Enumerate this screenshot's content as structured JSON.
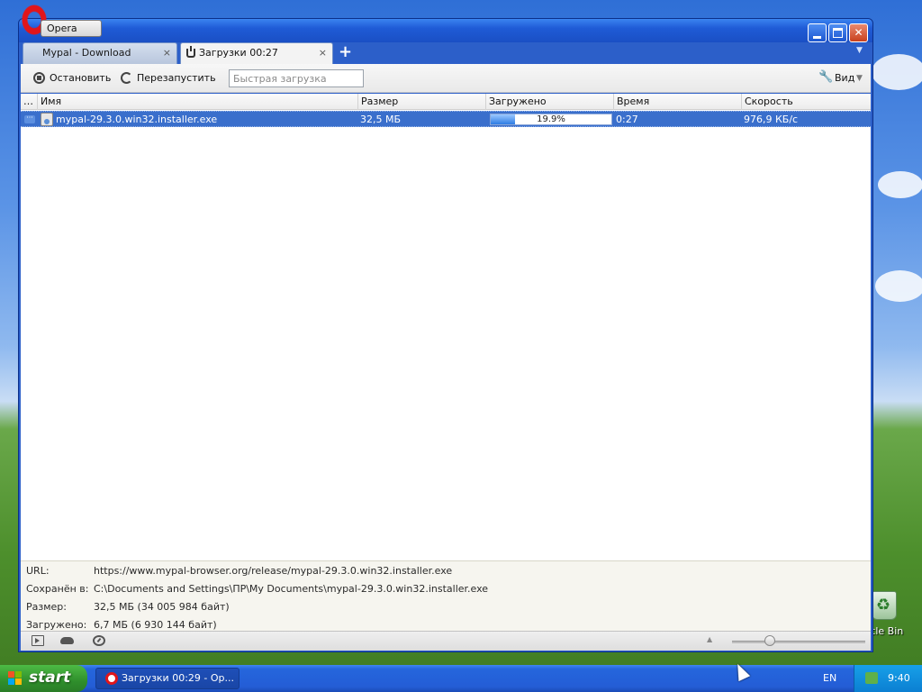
{
  "window": {
    "app_button": "Opera"
  },
  "tabs": [
    {
      "label": "Mypal - Download",
      "close": "×"
    },
    {
      "label": "Загрузки 00:27",
      "close": "×"
    }
  ],
  "tab_add": "+",
  "toolbar": {
    "stop_label": "Остановить",
    "restart_label": "Перезапустить",
    "quick_placeholder": "Быстрая загрузка",
    "view_label": "Вид"
  },
  "table": {
    "columns": [
      "…",
      "Имя",
      "Размер",
      "Загружено",
      "Время",
      "Скорость"
    ],
    "rows": [
      {
        "name": "mypal-29.3.0.win32.installer.exe",
        "size": "32,5 МБ",
        "progress_text": "19.9%",
        "progress_fraction": 0.199,
        "time": "0:27",
        "speed": "976,9 КБ/с"
      }
    ]
  },
  "details": {
    "url_label": "URL:",
    "url_value": "https://www.mypal-browser.org/release/mypal-29.3.0.win32.installer.exe",
    "saved_label": "Сохранён в:",
    "saved_value": "C:\\Documents and Settings\\ПР\\My Documents\\mypal-29.3.0.win32.installer.exe",
    "size_label": "Размер:",
    "size_value": "32,5 МБ (34 005 984 байт)",
    "downloaded_label": "Загружено:",
    "downloaded_value": "6,7 МБ (6 930 144 байт)"
  },
  "desktop": {
    "recycle_label": "rcle Bin"
  },
  "taskbar": {
    "start_label": "start",
    "task_label": "Загрузки 00:29 - Op...",
    "lang": "EN",
    "clock": "9:40"
  },
  "colors": {
    "selection": "#3a6fcc",
    "titlebar": "#1f5bd6",
    "start": "#2f8f2c"
  }
}
